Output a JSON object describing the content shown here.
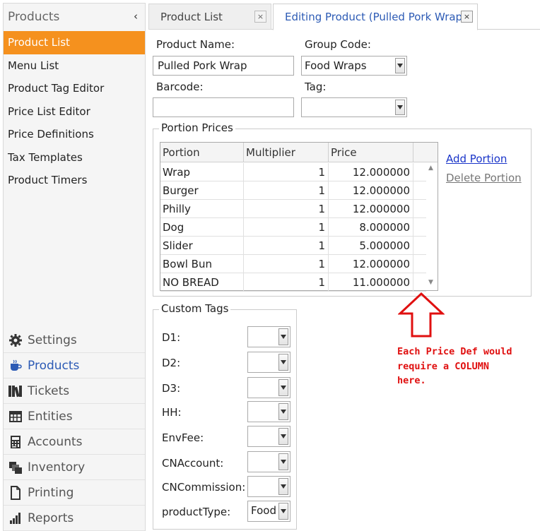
{
  "sidebar": {
    "title": "Products",
    "collapse_glyph": "‹",
    "items": [
      {
        "label": "Product List",
        "active": true
      },
      {
        "label": "Menu List"
      },
      {
        "label": "Product Tag Editor"
      },
      {
        "label": "Price List Editor"
      },
      {
        "label": "Price Definitions"
      },
      {
        "label": "Tax Templates"
      },
      {
        "label": "Product Timers"
      }
    ],
    "nav": [
      {
        "label": "Settings",
        "icon": "gear-icon"
      },
      {
        "label": "Products",
        "icon": "coffee-cup-icon",
        "active": true
      },
      {
        "label": "Tickets",
        "icon": "books-icon"
      },
      {
        "label": "Entities",
        "icon": "table-icon"
      },
      {
        "label": "Accounts",
        "icon": "calculator-icon"
      },
      {
        "label": "Inventory",
        "icon": "stack-icon"
      },
      {
        "label": "Printing",
        "icon": "document-icon"
      },
      {
        "label": "Reports",
        "icon": "bar-chart-icon"
      }
    ]
  },
  "tabs": [
    {
      "label": "Product List",
      "close": "×"
    },
    {
      "label": "Editing Product (Pulled Pork Wrap)",
      "close": "×",
      "active": true
    }
  ],
  "form": {
    "product_name_label": "Product Name:",
    "product_name_value": "Pulled Pork Wrap",
    "group_code_label": "Group Code:",
    "group_code_value": "Food Wraps",
    "barcode_label": "Barcode:",
    "barcode_value": "",
    "tag_label": "Tag:",
    "tag_value": ""
  },
  "portion_prices": {
    "title": "Portion Prices",
    "columns": [
      "Portion",
      "Multiplier",
      "Price"
    ],
    "rows": [
      {
        "portion": "Wrap",
        "multiplier": "1",
        "price": "12.000000"
      },
      {
        "portion": "Burger",
        "multiplier": "1",
        "price": "12.000000"
      },
      {
        "portion": "Philly",
        "multiplier": "1",
        "price": "12.000000"
      },
      {
        "portion": "Dog",
        "multiplier": "1",
        "price": "8.000000"
      },
      {
        "portion": "Slider",
        "multiplier": "1",
        "price": "5.000000"
      },
      {
        "portion": "Bowl Bun",
        "multiplier": "1",
        "price": "12.000000"
      },
      {
        "portion": "NO BREAD",
        "multiplier": "1",
        "price": "11.000000"
      }
    ],
    "add_portion": "Add Portion",
    "delete_portion": "Delete Portion"
  },
  "custom_tags": {
    "title": "Custom Tags",
    "tags": [
      {
        "label": "D1:",
        "value": ""
      },
      {
        "label": "D2:",
        "value": ""
      },
      {
        "label": "D3:",
        "value": ""
      },
      {
        "label": "HH:",
        "value": ""
      },
      {
        "label": "EnvFee:",
        "value": ""
      },
      {
        "label": "CNAccount:",
        "value": ""
      },
      {
        "label": "CNCommission:",
        "value": ""
      },
      {
        "label": "productType:",
        "value": "Food"
      }
    ]
  },
  "annotation": {
    "lines": [
      "Each Price Def would",
      "require a COLUMN",
      "here."
    ],
    "color": "#e01010"
  },
  "colors": {
    "accent": "#f5911e",
    "nav_active": "#2d5bb5",
    "link": "#1a35c9"
  }
}
